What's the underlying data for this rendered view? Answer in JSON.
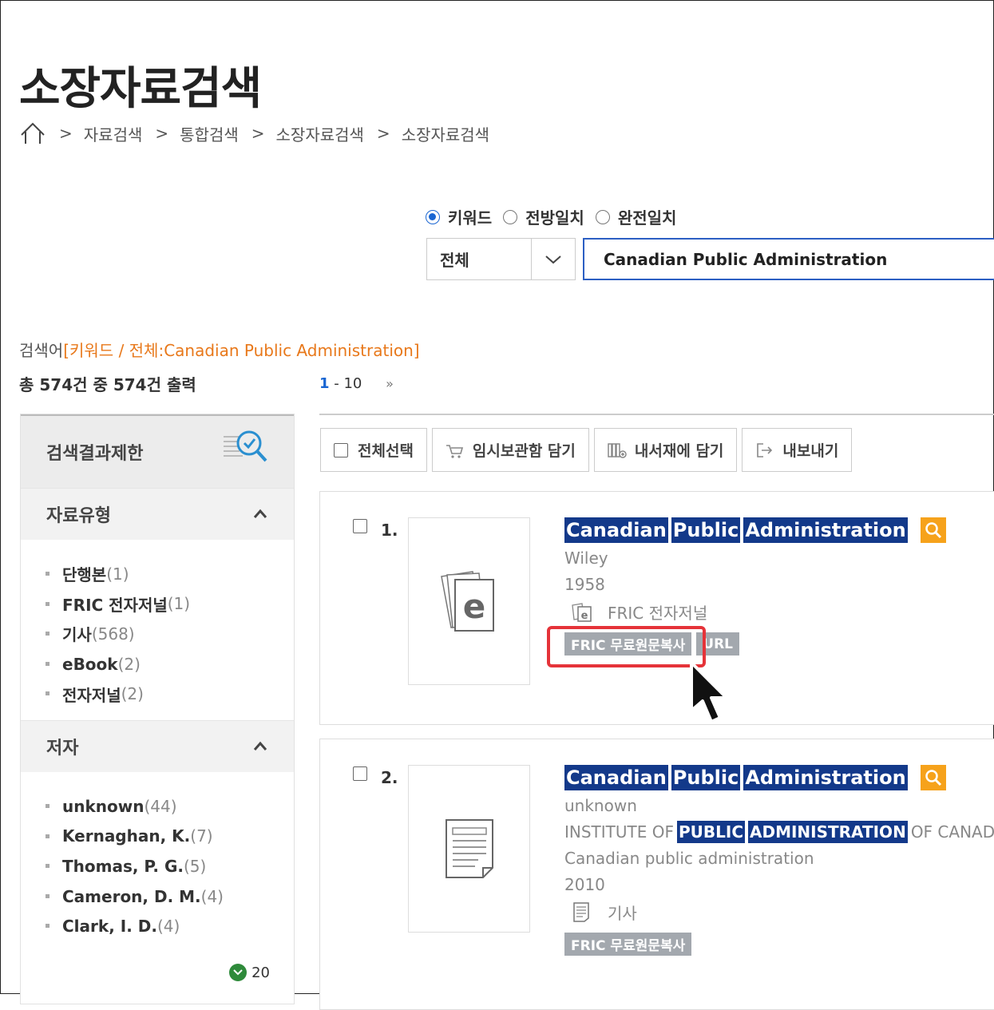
{
  "page": {
    "title": "소장자료검색",
    "breadcrumb": [
      "자료검색",
      "통합검색",
      "소장자료검색",
      "소장자료검색"
    ]
  },
  "search": {
    "modes": [
      {
        "label": "키워드",
        "checked": true
      },
      {
        "label": "전방일치",
        "checked": false
      },
      {
        "label": "완전일치",
        "checked": false
      }
    ],
    "scope": "전체",
    "query": "Canadian Public Administration"
  },
  "summary": {
    "query_prefix": "검색어",
    "query_detail": "[키워드 / 전체:Canadian Public Administration]",
    "count_text": "총 574건 중 574건 출력",
    "range_start": "1",
    "range_end": "- 10",
    "next": "»"
  },
  "sidebar": {
    "title": "검색결과제한",
    "sections": [
      {
        "title": "자료유형",
        "items": [
          {
            "label": "단행본",
            "count": "(1)"
          },
          {
            "label": "FRIC 전자저널",
            "count": "(1)"
          },
          {
            "label": "기사",
            "count": "(568)"
          },
          {
            "label": "eBook",
            "count": "(2)"
          },
          {
            "label": "전자저널",
            "count": "(2)"
          }
        ]
      },
      {
        "title": "저자",
        "items": [
          {
            "label": "unknown",
            "count": "(44)"
          },
          {
            "label": "Kernaghan, K.",
            "count": "(7)"
          },
          {
            "label": "Thomas, P. G.",
            "count": "(5)"
          },
          {
            "label": "Cameron, D. M.",
            "count": "(4)"
          },
          {
            "label": "Clark, I. D.",
            "count": "(4)"
          }
        ],
        "more": "20"
      }
    ]
  },
  "toolbar": {
    "select_all": "전체선택",
    "temp_save": "임시보관함 담기",
    "my_shelf": "내서재에 담기",
    "export": "내보내기"
  },
  "results": [
    {
      "num": "1.",
      "title_words": [
        "Canadian",
        "Public",
        "Administration"
      ],
      "publisher": "Wiley",
      "year": "1958",
      "type": "FRIC 전자저널",
      "tags": [
        "FRIC 무료원문복사",
        "URL"
      ]
    },
    {
      "num": "2.",
      "title_words": [
        "Canadian",
        "Public",
        "Administration"
      ],
      "author": "unknown",
      "org_prefix": "INSTITUTE OF",
      "org_hl1": "PUBLIC",
      "org_hl2": "ADMINISTRATION",
      "org_suffix": "OF CANADA",
      "source": "Canadian public administration",
      "year": "2010",
      "type": "기사",
      "tags": [
        "FRIC 무료원문복사"
      ]
    }
  ],
  "colors": {
    "accent_blue": "#13398a",
    "query_orange": "#e8781a",
    "highlight_red": "#e53339",
    "search_orange": "#f6a21b"
  }
}
